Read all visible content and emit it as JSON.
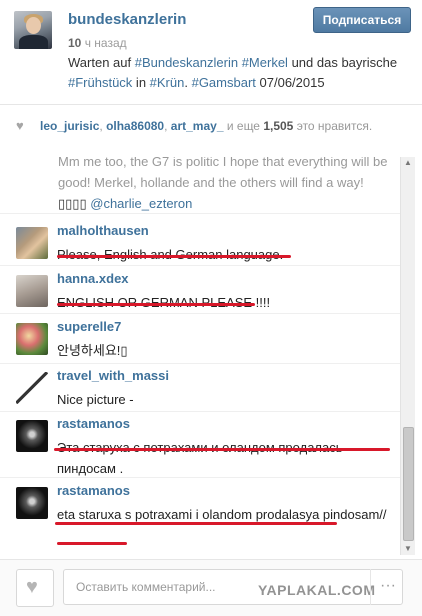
{
  "post": {
    "username": "bundeskanzlerin",
    "time_number": "10",
    "time_unit": "ч назад",
    "caption": "Warten auf #Bundeskanzlerin #Merkel und das bayrische #Frühstück in #Krün. #Gamsbart 07/06/2015",
    "follow_label": "Подписаться"
  },
  "likes": {
    "users": [
      "leo_jurisic",
      "olha86080",
      "art_may_"
    ],
    "separator": ",",
    "more_text": "и еще",
    "count": "1,505",
    "suffix": "это нравится."
  },
  "comments": {
    "first_text_top": "Mm me too, the G7 is politic I hope that everything will be good! Merkel, hollande and the others will find a way! ",
    "first_text_boxes": "▯▯▯▯",
    "first_text_tag": "@charlie_ezteron",
    "items": [
      {
        "name": "malholthausen",
        "text": "Please, English and German language."
      },
      {
        "name": "hanna.xdex",
        "text": "ENGLISH OR GERMAN PLEASE !!!!"
      },
      {
        "name": "superelle7",
        "text": "안녕하세요!▯"
      },
      {
        "name": "travel_with_massi",
        "text": "Nice picture -"
      },
      {
        "name": "rastamanos",
        "text": "Эта старуха с потрахами и оландом продалась пиндосам ."
      },
      {
        "name": "rastamanos",
        "text": "eta staruxa s potraxami i olandom prodalasya pindosam//"
      }
    ]
  },
  "footer": {
    "comment_placeholder": "Оставить комментарий...",
    "watermark": "YAPLAKAL.COM",
    "more_icon": "···"
  },
  "colors": {
    "link": "#3f729b",
    "underline": "#d8182a",
    "follow_button": "#5a84ab"
  },
  "icons": [
    "heart-icon",
    "ellipsis-icon",
    "scroll-up-icon",
    "scroll-down-icon"
  ]
}
